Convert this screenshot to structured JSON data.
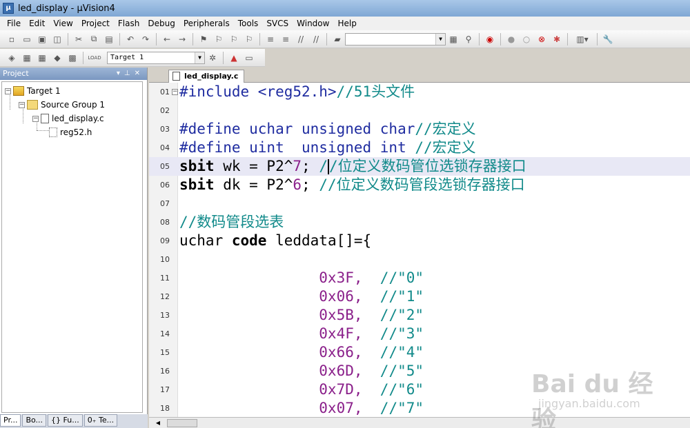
{
  "window": {
    "title": "led_display - µVision4"
  },
  "menu": [
    "File",
    "Edit",
    "View",
    "Project",
    "Flash",
    "Debug",
    "Peripherals",
    "Tools",
    "SVCS",
    "Window",
    "Help"
  ],
  "toolbar2": {
    "target_value": "Target 1"
  },
  "project_panel": {
    "title": "Project",
    "tree": {
      "target": "Target 1",
      "group": "Source Group 1",
      "file": "led_display.c",
      "header": "reg52.h"
    },
    "tabs": [
      "Pr...",
      "Bo...",
      "{} Fu...",
      "0₊ Te..."
    ]
  },
  "editor": {
    "tab_label": "led_display.c",
    "lines": [
      {
        "num": "01",
        "parts": [
          {
            "t": "#include <reg52.h>",
            "c": "pp"
          },
          {
            "t": "//51头文件",
            "c": "cm"
          }
        ],
        "fold": "⊟"
      },
      {
        "num": "02",
        "parts": []
      },
      {
        "num": "03",
        "parts": [
          {
            "t": "#define uchar unsigned char",
            "c": "pp"
          },
          {
            "t": "//宏定义",
            "c": "cm"
          }
        ]
      },
      {
        "num": "04",
        "parts": [
          {
            "t": "#define uint  unsigned int ",
            "c": "pp"
          },
          {
            "t": "//宏定义",
            "c": "cm"
          }
        ]
      },
      {
        "num": "05",
        "parts": [
          {
            "t": "sbit",
            "c": "kw"
          },
          {
            "t": " wk = P2^",
            "c": "op"
          },
          {
            "t": "7",
            "c": "num"
          },
          {
            "t": "; ",
            "c": "op"
          },
          {
            "t": "/",
            "c": "cm"
          },
          {
            "t": "",
            "c": "cursor"
          },
          {
            "t": "/位定义数码管位选锁存器接口",
            "c": "cm"
          }
        ],
        "highlight": true
      },
      {
        "num": "06",
        "parts": [
          {
            "t": "sbit",
            "c": "kw"
          },
          {
            "t": " dk = P2^",
            "c": "op"
          },
          {
            "t": "6",
            "c": "num"
          },
          {
            "t": "; ",
            "c": "op"
          },
          {
            "t": "//位定义数码管段选锁存器接口",
            "c": "cm"
          }
        ]
      },
      {
        "num": "07",
        "parts": []
      },
      {
        "num": "08",
        "parts": [
          {
            "t": "//数码管段选表",
            "c": "cm"
          }
        ]
      },
      {
        "num": "09",
        "parts": [
          {
            "t": "uchar ",
            "c": "op"
          },
          {
            "t": "code",
            "c": "kw"
          },
          {
            "t": " leddata[]={",
            "c": "op"
          }
        ]
      },
      {
        "num": "10",
        "parts": []
      },
      {
        "num": "11",
        "parts": [
          {
            "t": "                0x3F,  ",
            "c": "num"
          },
          {
            "t": "//\"0\"",
            "c": "cm"
          }
        ]
      },
      {
        "num": "12",
        "parts": [
          {
            "t": "                0x06,  ",
            "c": "num"
          },
          {
            "t": "//\"1\"",
            "c": "cm"
          }
        ]
      },
      {
        "num": "13",
        "parts": [
          {
            "t": "                0x5B,  ",
            "c": "num"
          },
          {
            "t": "//\"2\"",
            "c": "cm"
          }
        ]
      },
      {
        "num": "14",
        "parts": [
          {
            "t": "                0x4F,  ",
            "c": "num"
          },
          {
            "t": "//\"3\"",
            "c": "cm"
          }
        ]
      },
      {
        "num": "15",
        "parts": [
          {
            "t": "                0x66,  ",
            "c": "num"
          },
          {
            "t": "//\"4\"",
            "c": "cm"
          }
        ]
      },
      {
        "num": "16",
        "parts": [
          {
            "t": "                0x6D,  ",
            "c": "num"
          },
          {
            "t": "//\"5\"",
            "c": "cm"
          }
        ]
      },
      {
        "num": "17",
        "parts": [
          {
            "t": "                0x7D,  ",
            "c": "num"
          },
          {
            "t": "//\"6\"",
            "c": "cm"
          }
        ]
      },
      {
        "num": "18",
        "parts": [
          {
            "t": "                0x07,  ",
            "c": "num"
          },
          {
            "t": "//\"7\"",
            "c": "cm"
          }
        ]
      }
    ]
  },
  "watermark": {
    "brand": "Bai du 经验",
    "url": "jingyan.baidu.com"
  }
}
